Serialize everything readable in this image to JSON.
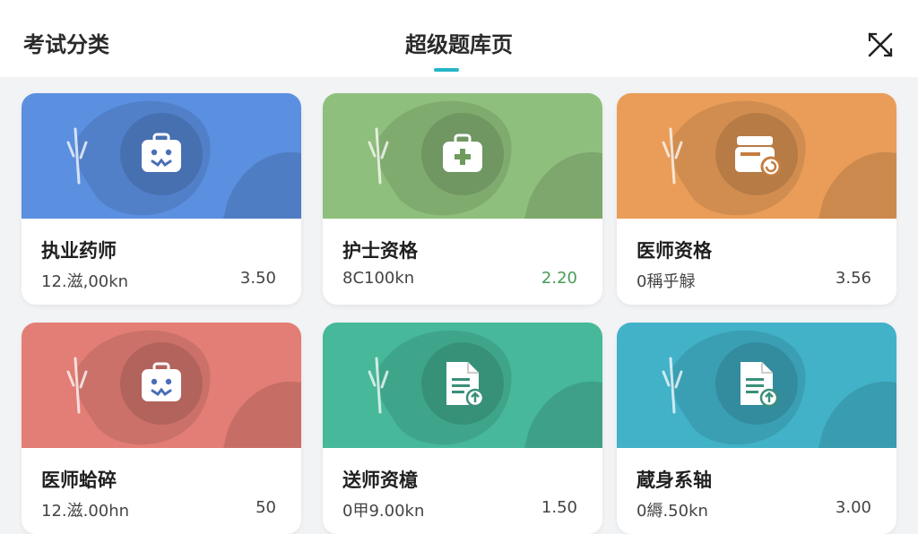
{
  "header": {
    "left_label": "考试分类",
    "title": "超级题库页"
  },
  "accent_color": "#26b5c8",
  "cards": [
    {
      "name": "执业药师",
      "count": "12.滋,00kn",
      "score": "3.50",
      "color": "#5b8fe0",
      "icon": "robot-case-icon"
    },
    {
      "name": "护士资格",
      "count": "8C100kn",
      "score": "2.20",
      "color": "#8fbf7c",
      "icon": "medical-kit-icon"
    },
    {
      "name": "医师资格",
      "count": "0稱乎觮",
      "score": "3.56",
      "color": "#e99d58",
      "icon": "register-refresh-icon"
    },
    {
      "name": "医师蛤碎",
      "count": "12.滋.00hn",
      "score": "50",
      "color": "#e27e75",
      "icon": "robot-case-icon"
    },
    {
      "name": "送师资檍",
      "count": "0甲9.00kn",
      "score": "1.50",
      "color": "#47b89a",
      "icon": "document-upload-icon"
    },
    {
      "name": "蔵身系轴",
      "count": "0縟.50kn",
      "score": "3.00",
      "color": "#42b2c9",
      "icon": "document-upload-icon"
    }
  ]
}
